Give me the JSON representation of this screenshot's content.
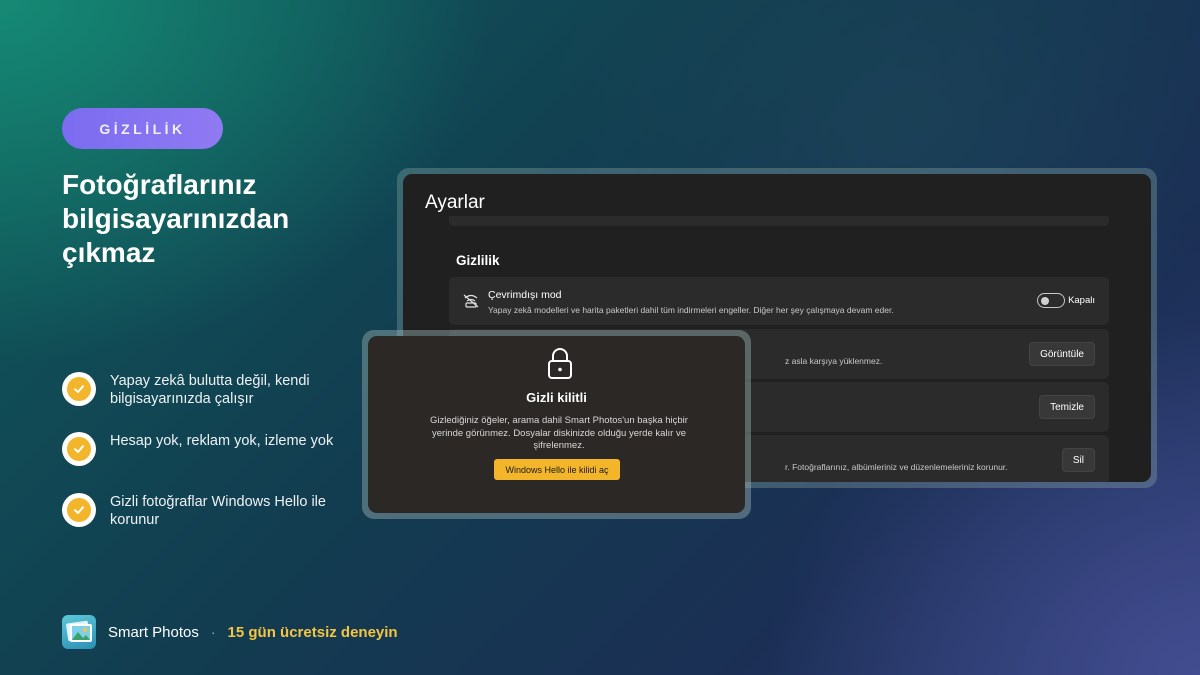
{
  "badge": "GİZLİLİK",
  "headline": "Fotoğraflarınız bilgisayarınızdan çıkmaz",
  "features": [
    "Yapay zekâ bulutta değil, kendi bilgisayarınızda çalışır",
    "Hesap yok, reklam yok, izleme yok",
    "Gizli fotoğraflar Windows Hello ile korunur"
  ],
  "footer": {
    "app_name": "Smart Photos",
    "separator": "·",
    "trial": "15 gün ücretsiz deneyin"
  },
  "settings": {
    "title": "Ayarlar",
    "section": "Gizlilik",
    "rows": [
      {
        "label": "Çevrimdışı mod",
        "desc": "Yapay zekâ modelleri ve harita paketleri dahil tüm indirmeleri engeller. Diğer her şey çalışmaya devam eder.",
        "toggle_label": "Kapalı",
        "toggle_on": false
      },
      {
        "desc_visible": "z asla karşıya yüklenmez.",
        "button": "Görüntüle"
      },
      {
        "button": "Temizle"
      },
      {
        "desc_visible": "r. Fotoğraflarınız, albümleriniz ve düzenlemeleriniz korunur.",
        "button": "Sil"
      }
    ]
  },
  "dialog": {
    "title": "Gizli kilitli",
    "text": "Gizlediğiniz öğeler, arama dahil Smart Photos'un başka hiçbir yerinde görünmez. Dosyalar diskinizde olduğu yerde kalır ve şifrelenmez.",
    "button": "Windows Hello ile kilidi aç"
  },
  "colors": {
    "accent_badge": "#7b6cf0",
    "accent_yellow": "#f3b52a",
    "trial_text": "#f5c542",
    "window_bg": "#202020",
    "row_bg": "#2b2b2b"
  },
  "icons": {
    "check": "check-icon",
    "offline": "offline-icon",
    "lock": "lock-icon",
    "app": "smart-photos-app-icon"
  }
}
